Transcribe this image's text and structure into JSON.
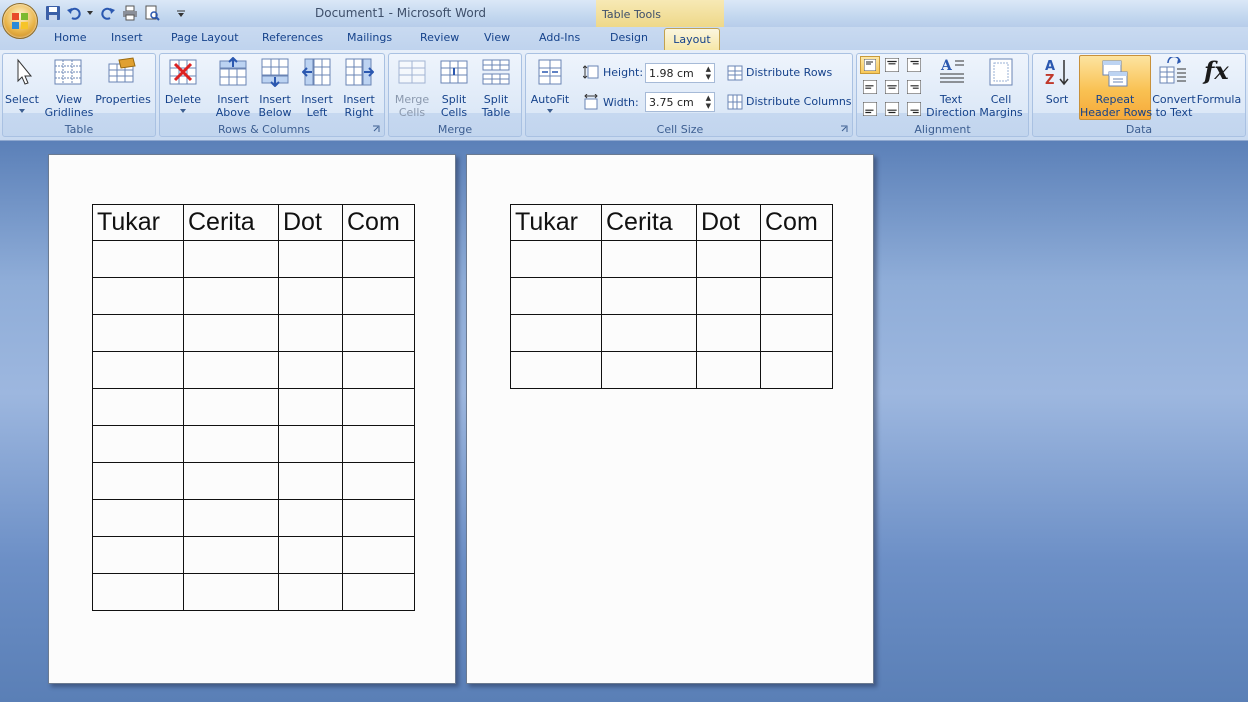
{
  "window": {
    "title": "Document1 - Microsoft Word",
    "context_label": "Table Tools"
  },
  "tabs": [
    "Home",
    "Insert",
    "Page Layout",
    "References",
    "Mailings",
    "Review",
    "View",
    "Add-Ins",
    "Design",
    "Layout"
  ],
  "active_tab": "Layout",
  "groups": {
    "table": {
      "label": "Table",
      "buttons": [
        {
          "l1": "Select",
          "l2": ""
        },
        {
          "l1": "View",
          "l2": "Gridlines"
        },
        {
          "l1": "Properties",
          "l2": ""
        }
      ]
    },
    "rows_columns": {
      "label": "Rows & Columns",
      "buttons": [
        {
          "l1": "Delete",
          "l2": ""
        },
        {
          "l1": "Insert",
          "l2": "Above"
        },
        {
          "l1": "Insert",
          "l2": "Below"
        },
        {
          "l1": "Insert",
          "l2": "Left"
        },
        {
          "l1": "Insert",
          "l2": "Right"
        }
      ]
    },
    "merge": {
      "label": "Merge",
      "buttons": [
        {
          "l1": "Merge",
          "l2": "Cells"
        },
        {
          "l1": "Split",
          "l2": "Cells"
        },
        {
          "l1": "Split",
          "l2": "Table"
        }
      ]
    },
    "cell_size": {
      "label": "Cell Size",
      "autofit": "AutoFit",
      "height_label": "Height:",
      "height_value": "1.98 cm",
      "width_label": "Width:",
      "width_value": "3.75 cm",
      "distribute_rows": "Distribute Rows",
      "distribute_columns": "Distribute Columns"
    },
    "alignment": {
      "label": "Alignment",
      "text_direction": {
        "l1": "Text",
        "l2": "Direction"
      },
      "cell_margins": {
        "l1": "Cell",
        "l2": "Margins"
      }
    },
    "data": {
      "label": "Data",
      "buttons": [
        {
          "l1": "Sort",
          "l2": ""
        },
        {
          "l1": "Repeat",
          "l2": "Header Rows"
        },
        {
          "l1": "Convert",
          "l2": "to Text"
        },
        {
          "l1": "Formula",
          "l2": ""
        }
      ]
    }
  },
  "document": {
    "headers": [
      "Tukar",
      "Cerita",
      "Dot",
      "Com"
    ],
    "page1_body_rows": 10,
    "page2_body_rows": 4
  }
}
